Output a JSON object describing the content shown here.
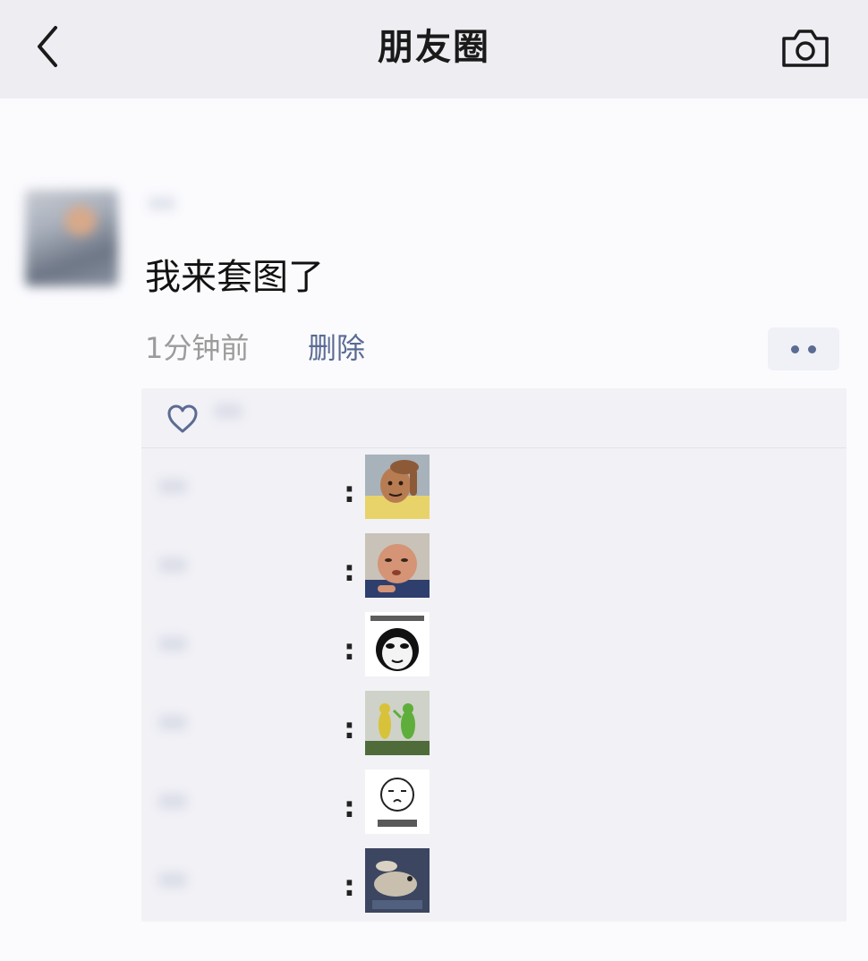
{
  "header": {
    "title": "朋友圈",
    "back_icon": "chevron-left-icon",
    "camera_icon": "camera-icon"
  },
  "post": {
    "author_name": "**",
    "text": "我来套图了",
    "time": "1分钟前",
    "delete_label": "删除",
    "more_icon": "more-dots-icon"
  },
  "likes": {
    "icon": "heart-icon",
    "names": "**"
  },
  "comments": [
    {
      "author": "**",
      "sticker": "bald-man-head-scratch-sticker"
    },
    {
      "author": "**",
      "sticker": "chubby-man-pout-sticker"
    },
    {
      "author": "**",
      "sticker": "panda-face-text-sticker"
    },
    {
      "author": "**",
      "sticker": "two-green-toys-sticker"
    },
    {
      "author": "**",
      "sticker": "sketch-face-text-sticker"
    },
    {
      "author": "**",
      "sticker": "lizard-hand-sticker"
    }
  ],
  "colors": {
    "header_bg": "#ededf2",
    "link_blue": "#5a6b94",
    "name_blue": "#7683a8",
    "comment_bg": "#f1f1f6"
  }
}
